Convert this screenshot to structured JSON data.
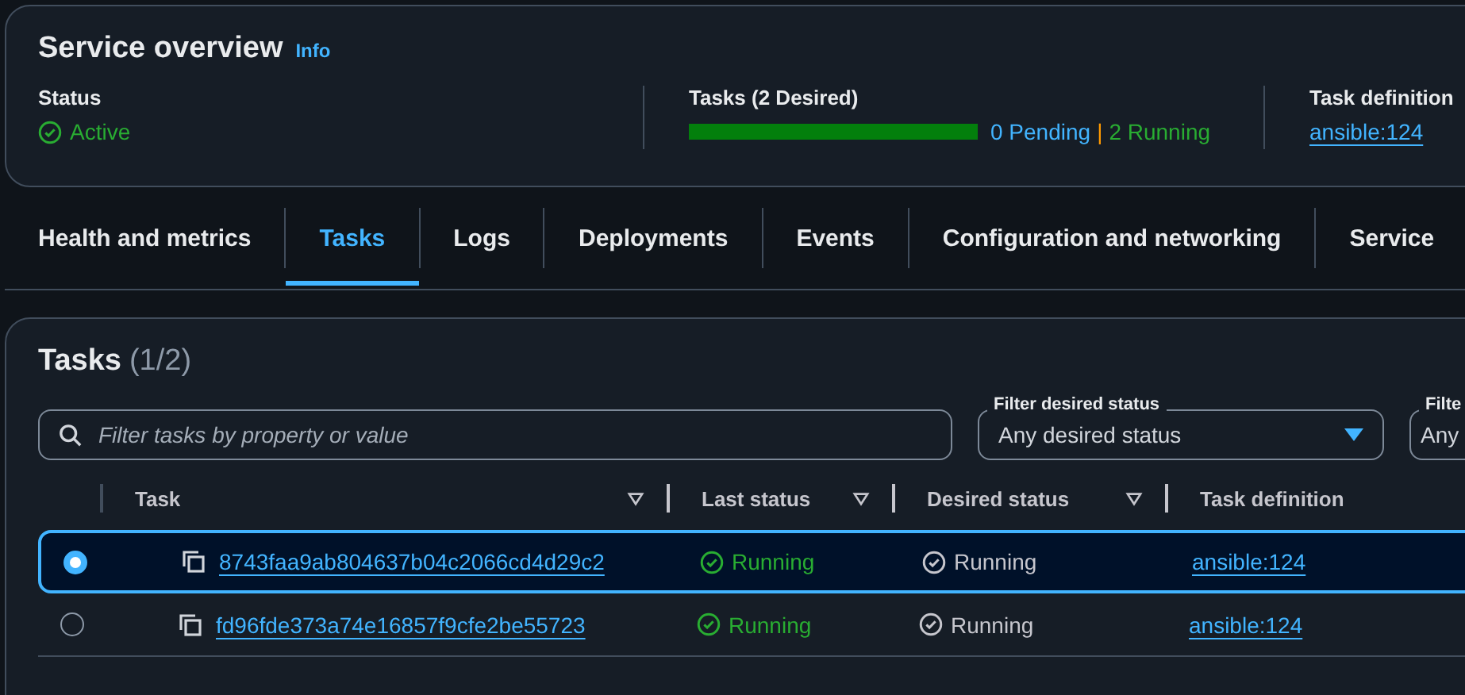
{
  "overview": {
    "title": "Service overview",
    "info": "Info",
    "status": {
      "label": "Status",
      "value": "Active"
    },
    "tasks": {
      "label": "Tasks (2 Desired)",
      "level": 1,
      "pending": "0 Pending",
      "separator": "|",
      "running": "2 Running"
    },
    "task_definition": {
      "label": "Task definition",
      "link": "ansible:124"
    }
  },
  "tabs": [
    {
      "label": "Health and metrics",
      "selected": false
    },
    {
      "label": "Tasks",
      "selected": true
    },
    {
      "label": "Logs",
      "selected": false
    },
    {
      "label": "Deployments",
      "selected": false
    },
    {
      "label": "Events",
      "selected": false
    },
    {
      "label": "Configuration and networking",
      "selected": false
    },
    {
      "label": "Service",
      "selected": false
    }
  ],
  "tasks_panel": {
    "title": "Tasks",
    "count": "(1/2)",
    "search": {
      "placeholder": "Filter tasks by property or value"
    },
    "filters": [
      {
        "label": "Filter desired status",
        "value": "Any desired status"
      },
      {
        "label": "Filte",
        "value": "Any"
      }
    ],
    "columns": [
      {
        "label": "Task",
        "sortable": true
      },
      {
        "label": "Last status",
        "sortable": true
      },
      {
        "label": "Desired status",
        "sortable": true
      },
      {
        "label": "Task definition",
        "sortable": false
      }
    ],
    "rows": [
      {
        "selected": true,
        "task": "8743faa9ab804637b04c2066cd4d29c2",
        "last_status": "Running",
        "desired_status": "Running",
        "task_definition": "ansible:124"
      },
      {
        "selected": false,
        "task": "fd96fde373a74e16857f9cfe2be55723",
        "last_status": "Running",
        "desired_status": "Running",
        "task_definition": "ansible:124"
      }
    ]
  }
}
